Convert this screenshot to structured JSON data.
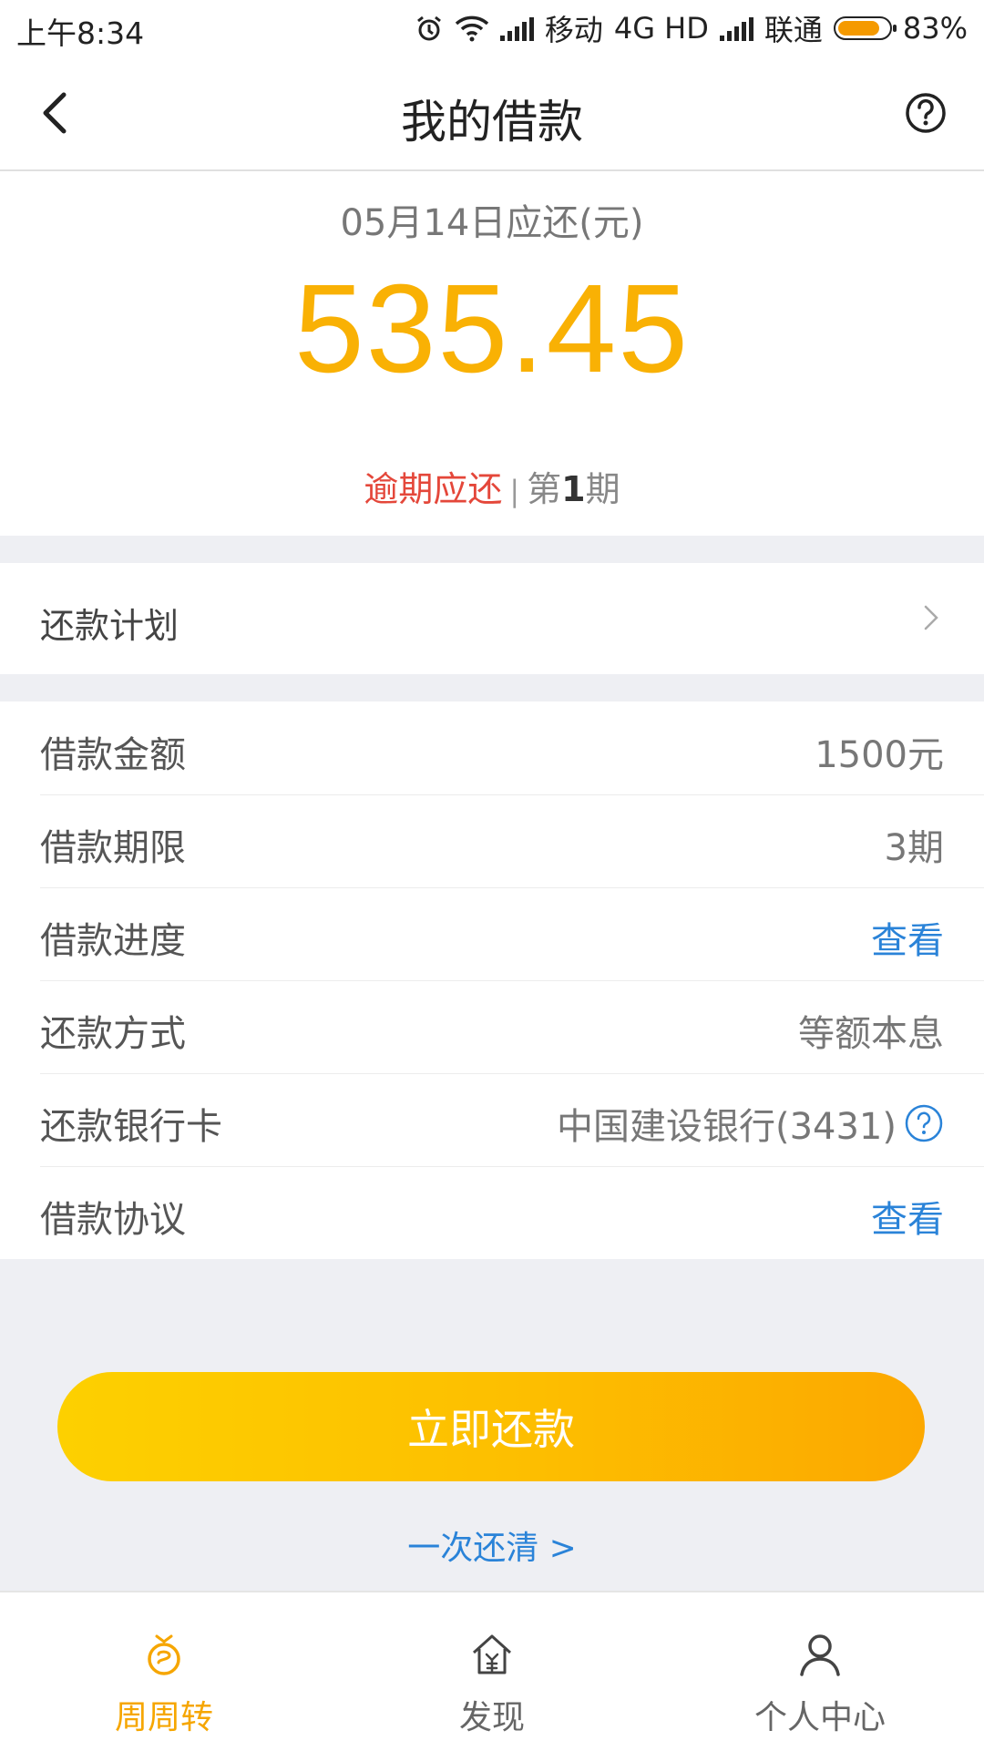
{
  "status_bar": {
    "time": "上午8:34",
    "carrier1": "移动",
    "network": "4G HD",
    "carrier2": "联通",
    "battery": "83%",
    "battery_level": 0.83
  },
  "header": {
    "title": "我的借款"
  },
  "summary": {
    "due_label": "05月14日应还(元)",
    "amount": "535.45",
    "overdue_text": "逾期应还",
    "separator": "|",
    "period_prefix": "第",
    "period_number": "1",
    "period_suffix": "期"
  },
  "plan": {
    "label": "还款计划"
  },
  "details": {
    "loan_amount": {
      "label": "借款金额",
      "value": "1500元"
    },
    "loan_term": {
      "label": "借款期限",
      "value": "3期"
    },
    "loan_progress": {
      "label": "借款进度",
      "value": "查看"
    },
    "repay_method": {
      "label": "还款方式",
      "value": "等额本息"
    },
    "repay_card": {
      "label": "还款银行卡",
      "value": "中国建设银行(3431)"
    },
    "loan_agreement": {
      "label": "借款协议",
      "value": "查看"
    }
  },
  "actions": {
    "repay_now": "立即还款",
    "pay_off": "一次还清 >"
  },
  "bottom_nav": {
    "items": [
      {
        "label": "周周转",
        "icon": "money-bag-icon",
        "active": true
      },
      {
        "label": "发现",
        "icon": "discover-house-icon",
        "active": false
      },
      {
        "label": "个人中心",
        "icon": "person-icon",
        "active": false
      }
    ]
  },
  "colors": {
    "accent": "#f9b104",
    "overdue": "#e4473a",
    "link": "#2a83d8"
  }
}
